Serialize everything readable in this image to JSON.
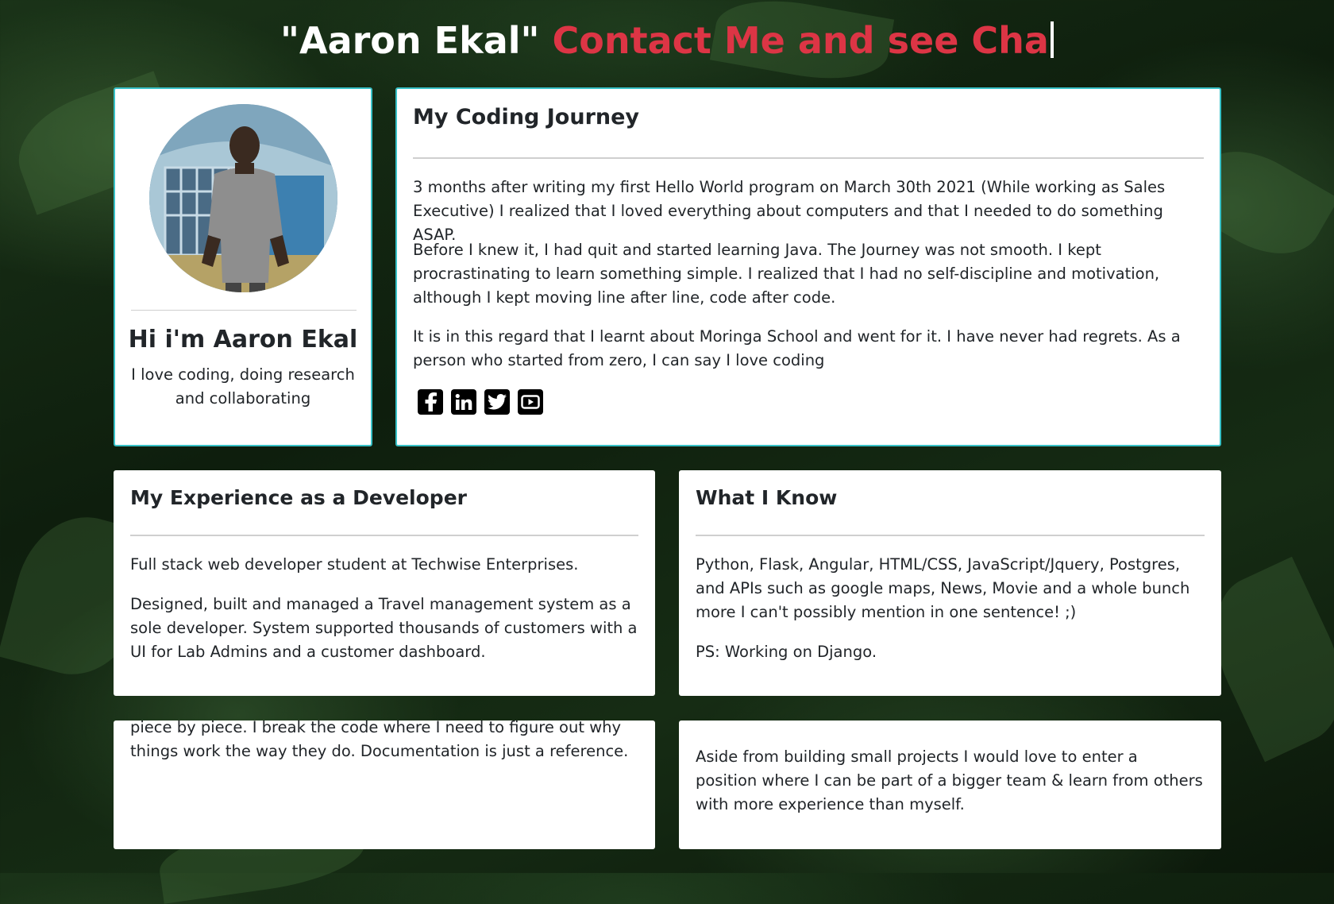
{
  "header": {
    "name": "\"Aaron Ekal\"",
    "typed_text": "Contact Me and see Cha"
  },
  "profile": {
    "name": "Hi i'm Aaron Ekal",
    "bio": "I love coding, doing research and collaborating"
  },
  "journey": {
    "title": "My Coding Journey",
    "paragraphs": [
      "3 months after writing my first Hello World program on March 30th 2021 (While working as Sales Executive) I realized that I loved everything about computers and that I needed to do something ASAP.",
      "Before I knew it, I had quit and started learning Java. The Journey was not smooth. I kept procrastinating to learn something simple. I realized that I had no self-discipline and motivation, although I kept moving line after line, code after code.",
      "It is in this regard that I learnt about Moringa School and went for it. I have never had regrets. As a person who started from zero, I can say I love coding"
    ],
    "social": [
      "facebook-icon",
      "linkedin-icon",
      "twitter-icon",
      "youtube-icon"
    ]
  },
  "experience": {
    "title": "My Experience as a Developer",
    "paragraphs": [
      "Full stack web developer student at Techwise Enterprises.",
      "Designed, built and managed a Travel management system as a sole developer. System supported thousands of customers with a UI for Lab Admins and a customer dashboard."
    ]
  },
  "know": {
    "title": "What I Know",
    "paragraphs": [
      "Python, Flask, Angular, HTML/CSS, JavaScript/Jquery, Postgres, and APIs such as google maps, News, Movie and a whole bunch more I can't possibly mention in one sentence! ;)",
      "PS: Working on Django."
    ]
  },
  "approach": {
    "text": "piece by piece. I break the code where I need to figure out why things work the way they do. Documentation is just a reference."
  },
  "goals": {
    "text": "Aside from building small projects I would love to enter a position where I can be part of a bigger team & learn from others with more experience than myself."
  },
  "colors": {
    "accent": "#dc3545",
    "card_border": "#38c1c7"
  }
}
